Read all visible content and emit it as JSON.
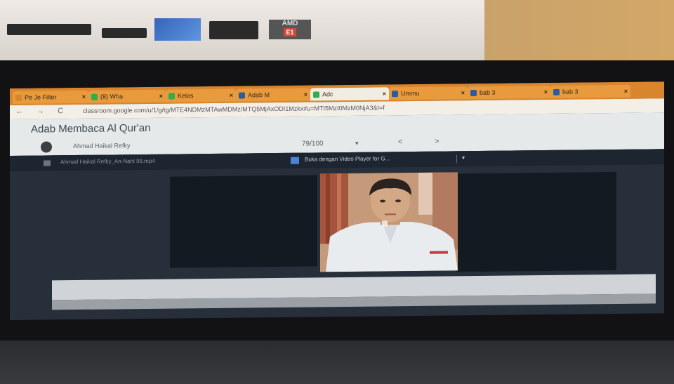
{
  "browser": {
    "tabs": [
      {
        "label": "Pe Je Filter",
        "favicon_color": "#d9852e"
      },
      {
        "label": "(8) Wha",
        "favicon_color": "#2fae4a"
      },
      {
        "label": "Kelas",
        "favicon_color": "#2fae4a"
      },
      {
        "label": "Adab M",
        "favicon_color": "#2a5d9a"
      },
      {
        "label": "Adc",
        "favicon_color": "#2fae4a",
        "active": true
      },
      {
        "label": "Ummu",
        "favicon_color": "#2a5d9a"
      },
      {
        "label": "bab 3",
        "favicon_color": "#2a5d9a"
      },
      {
        "label": "bab 3",
        "favicon_color": "#2a5d9a"
      }
    ],
    "nav": "← → C",
    "url": "classroom.google.com/u/1/g/tg/MTE4NDMzMTAwMDMz/MTQ5MjAxODI1Mzkx#u=MTI5MzI0MzM0NjA3&t=f"
  },
  "page": {
    "title": "Adab Membaca Al Qur'an",
    "student_name": "Ahmad Haikal Refky",
    "grade": "79/100",
    "grade_caret": "▾",
    "prev": "<",
    "next": ">"
  },
  "viewer": {
    "file_name": "Ahmad Haikal Refky_An-Nahl 98.mp4",
    "open_with": "Buka dengan Video Player for G...",
    "open_with_caret": "▾"
  },
  "stickers": {
    "amd": "AMD",
    "amd_sub": "E1"
  }
}
